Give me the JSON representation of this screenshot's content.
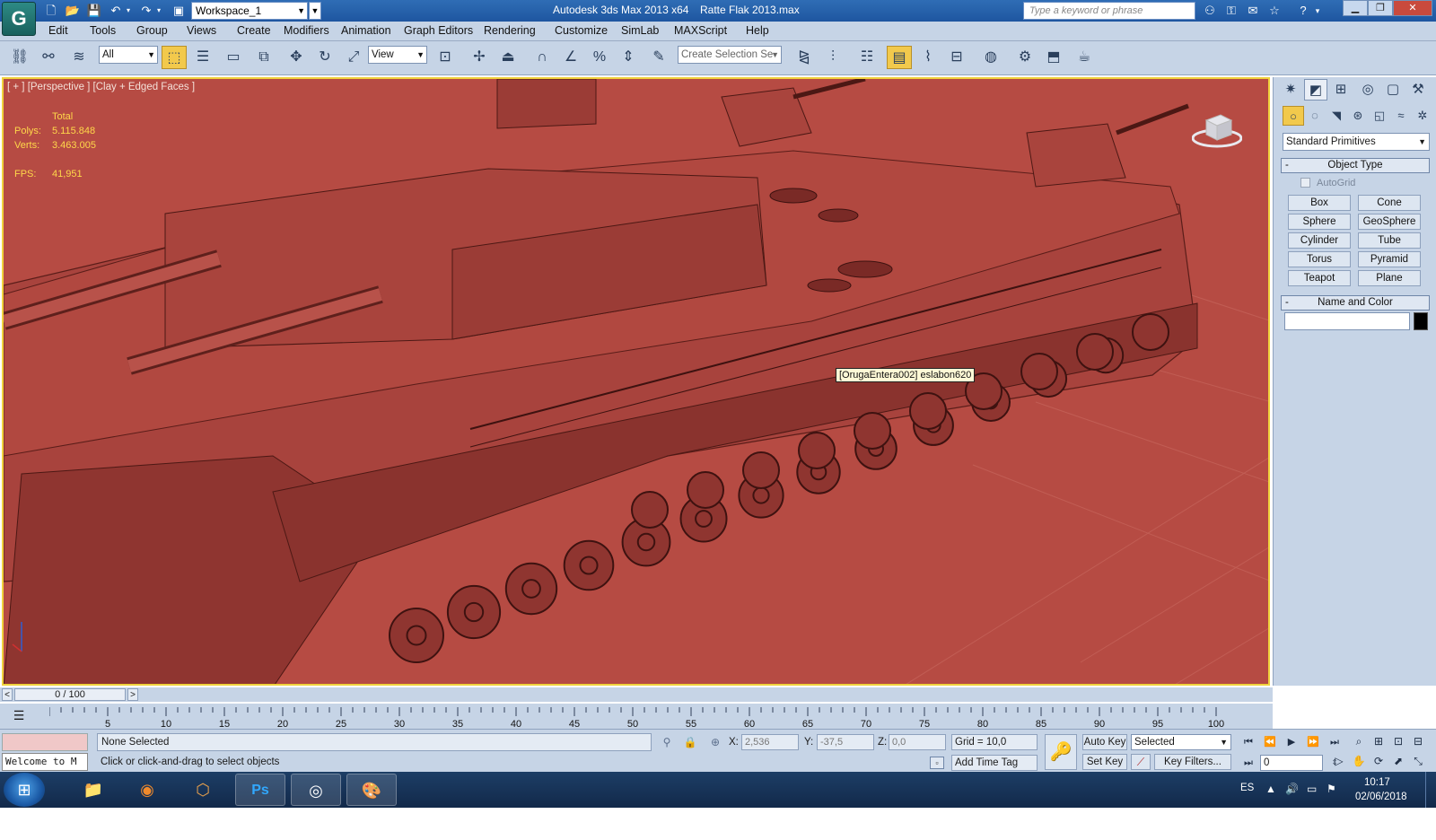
{
  "titlebar": {
    "logo": "G",
    "workspace": "Workspace_1",
    "app_title": "Autodesk 3ds Max  2013 x64",
    "file_title": "Ratte Flak 2013.max",
    "search_placeholder": "Type a keyword or phrase"
  },
  "menu": [
    "Edit",
    "Tools",
    "Group",
    "Views",
    "Create",
    "Modifiers",
    "Animation",
    "Graph Editors",
    "Rendering",
    "Customize",
    "SimLab",
    "MAXScript",
    "Help"
  ],
  "toolbar": {
    "filter": "All",
    "ref_coord": "View",
    "selection_set": "Create Selection Se"
  },
  "viewport": {
    "label": "[ + ] [Perspective ] [Clay + Edged Faces ]",
    "stats_header": "Total",
    "polys_label": "Polys:",
    "polys_value": "5.115.848",
    "verts_label": "Verts:",
    "verts_value": "3.463.005",
    "fps_label": "FPS:",
    "fps_value": "41,951",
    "tooltip": "[OrugaEntera002] eslabon620",
    "background": "#b64b43"
  },
  "command_panel": {
    "category": "Standard Primitives",
    "object_type_title": "Object Type",
    "autogrid": "AutoGrid",
    "buttons": [
      "Box",
      "Cone",
      "Sphere",
      "GeoSphere",
      "Cylinder",
      "Tube",
      "Torus",
      "Pyramid",
      "Teapot",
      "Plane"
    ],
    "name_color_title": "Name and Color"
  },
  "timeline": {
    "slider": "0 / 100",
    "ticks": [
      "5",
      "10",
      "15",
      "20",
      "25",
      "30",
      "35",
      "40",
      "45",
      "50",
      "55",
      "60",
      "65",
      "70",
      "75",
      "80",
      "85",
      "90",
      "95",
      "100"
    ]
  },
  "status": {
    "maxscript": "Welcome to M",
    "selection": "None Selected",
    "prompt": "Click or click-and-drag to select objects",
    "x_label": "X:",
    "x_value": "2,536",
    "y_label": "Y:",
    "y_value": "-37,5",
    "z_label": "Z:",
    "z_value": "0,0",
    "grid": "Grid = 10,0",
    "add_time_tag": "Add Time Tag",
    "auto_key": "Auto Key",
    "set_key": "Set Key",
    "key_mode": "Selected",
    "key_filters": "Key Filters...",
    "frame": "0"
  },
  "taskbar": {
    "language": "ES",
    "time": "10:17",
    "date": "02/06/2018"
  },
  "colors": {
    "viewport_border": "#f0d23c",
    "active_tool": "#f2c94c",
    "stats_text": "#ffd84a"
  }
}
